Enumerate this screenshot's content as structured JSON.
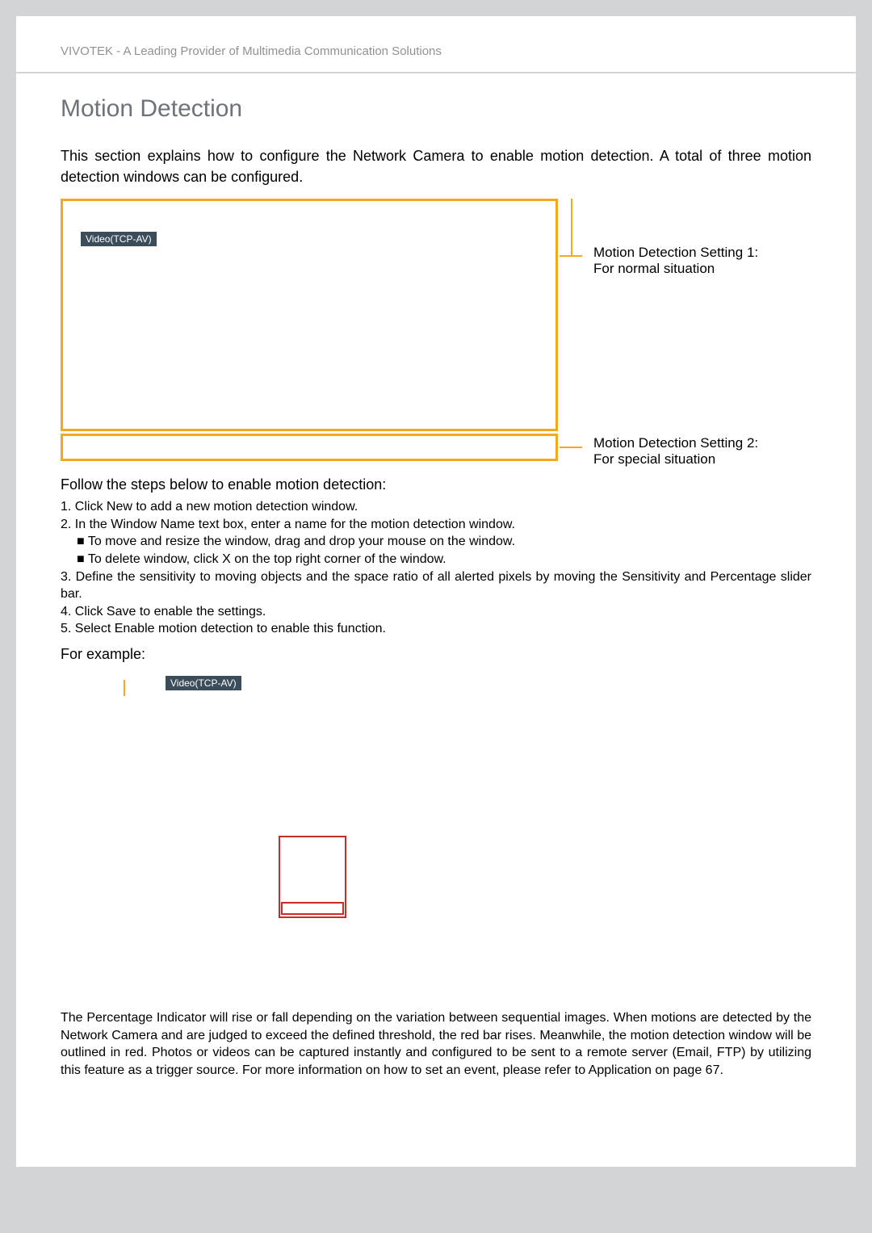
{
  "header": {
    "company_line": "VIVOTEK - A Leading Provider of Multimedia Communication Solutions"
  },
  "section": {
    "title": "Motion Detection",
    "intro": "This section explains how to configure the Network Camera to enable motion detection. A total of three motion detection windows can be configured."
  },
  "shot1": {
    "video_label": "Video(TCP-AV)",
    "callout1_line1": "Motion Detection Setting 1:",
    "callout1_line2": "For normal situation",
    "callout2_line1": "Motion Detection Setting 2:",
    "callout2_line2": "For special situation"
  },
  "instructions": {
    "follow": "Follow the steps below to enable motion detection:",
    "step1": "1. Click New to add a new motion detection window.",
    "step2": "2. In the Window Name text box, enter a name for the motion detection window.",
    "step2a": "■ To move and resize the window, drag and drop your mouse on the window.",
    "step2b": "■ To delete window, click X on the top right corner of the window.",
    "step3": "3. Define the sensitivity to moving objects and the space ratio of all alerted pixels by moving the Sensitivity and Percentage slider bar.",
    "step4": "4. Click Save to enable the settings.",
    "step5": "5. Select Enable motion detection   to enable this function.",
    "for_example": "For example:"
  },
  "shot2": {
    "video_label": "Video(TCP-AV)"
  },
  "footer_text": {
    "percentage": "The Percentage Indicator will rise or fall depending on the variation between sequential images. When motions are detected by the Network Camera and are judged to exceed the defined threshold, the red bar rises. Meanwhile, the motion detection window will be outlined in red. Photos or videos can be captured instantly and configured to be sent to a remote server (Email, FTP) by utilizing this feature as a trigger source. For more information on how to set an event, please refer to Application on page 67."
  }
}
